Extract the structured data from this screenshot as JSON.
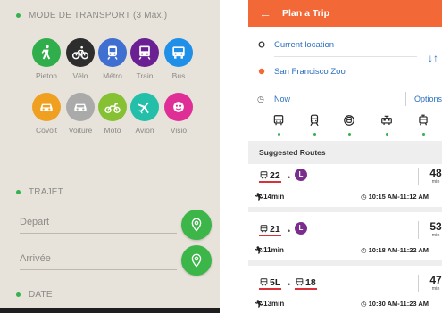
{
  "left": {
    "transport_section": "MODE DE TRANSPORT (3 Max.)",
    "modes": [
      {
        "label": "Pieton",
        "icon": "walk-icon",
        "color": "#2fae4b"
      },
      {
        "label": "Vélo",
        "icon": "bike-icon",
        "color": "#2d2d2d"
      },
      {
        "label": "Métro",
        "icon": "metro-icon",
        "color": "#3f6fd0"
      },
      {
        "label": "Train",
        "icon": "train-icon",
        "color": "#6a1f93"
      },
      {
        "label": "Bus",
        "icon": "bus-icon",
        "color": "#1f8fe8"
      },
      {
        "label": "Covoit",
        "icon": "carpool-icon",
        "color": "#f0a020"
      },
      {
        "label": "Voiture",
        "icon": "car-icon",
        "color": "#aaaaaa"
      },
      {
        "label": "Moto",
        "icon": "moto-icon",
        "color": "#85c132"
      },
      {
        "label": "Avion",
        "icon": "plane-icon",
        "color": "#23bfa9"
      },
      {
        "label": "Visio",
        "icon": "visio-icon",
        "color": "#df2e95"
      }
    ],
    "trajet_section": "TRAJET",
    "depart_placeholder": "Départ",
    "arrivee_placeholder": "Arrivée",
    "date_section": "DATE"
  },
  "right": {
    "title": "Plan a Trip",
    "origin": "Current location",
    "destination": "San Francisco Zoo",
    "time_mode": "Now",
    "options_label": "Options",
    "suggested_title": "Suggested Routes",
    "routes": [
      {
        "legs": [
          {
            "kind": "bus",
            "num": "22"
          }
        ],
        "line_badge": "L",
        "minutes": "48",
        "unit": "min",
        "walk": "14min",
        "time_range": "10:15 AM-11:12 AM"
      },
      {
        "legs": [
          {
            "kind": "bus",
            "num": "21"
          }
        ],
        "line_badge": "L",
        "minutes": "53",
        "unit": "min",
        "walk": "11min",
        "time_range": "10:18 AM-11:22 AM"
      },
      {
        "legs": [
          {
            "kind": "bus",
            "num": "5L"
          },
          {
            "kind": "bus",
            "num": "18"
          }
        ],
        "line_badge": "",
        "minutes": "47",
        "unit": "min",
        "walk": "13min",
        "time_range": "10:30 AM-11:23 AM"
      }
    ],
    "colors": {
      "accent": "#f26837",
      "link": "#2a6fc0",
      "route_underline": "#d9303a",
      "line_l": "#7b2d8e"
    }
  }
}
